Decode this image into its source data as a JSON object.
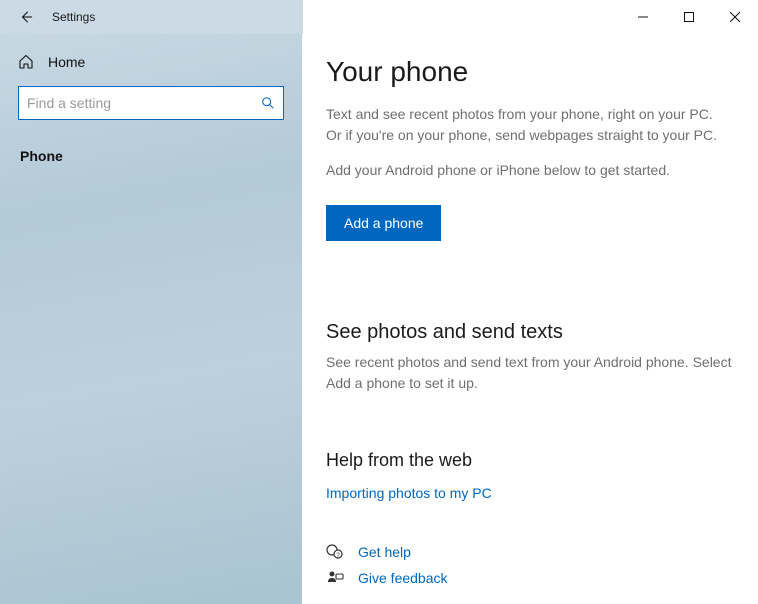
{
  "titlebar": {
    "title": "Settings"
  },
  "sidebar": {
    "home_label": "Home",
    "search_placeholder": "Find a setting",
    "nav": {
      "phone": "Phone"
    }
  },
  "main": {
    "title": "Your phone",
    "desc1": "Text and see recent photos from your phone, right on your PC. Or if you're on your phone, send webpages straight to your PC.",
    "desc2": "Add your Android phone or iPhone below to get started.",
    "add_phone_label": "Add a phone",
    "section2_title": "See photos and send texts",
    "section2_desc": "See recent photos and send text from your Android phone. Select Add a phone to set it up.",
    "help_title": "Help from the web",
    "help_link": "Importing photos to my PC",
    "get_help_label": "Get help",
    "give_feedback_label": "Give feedback"
  }
}
